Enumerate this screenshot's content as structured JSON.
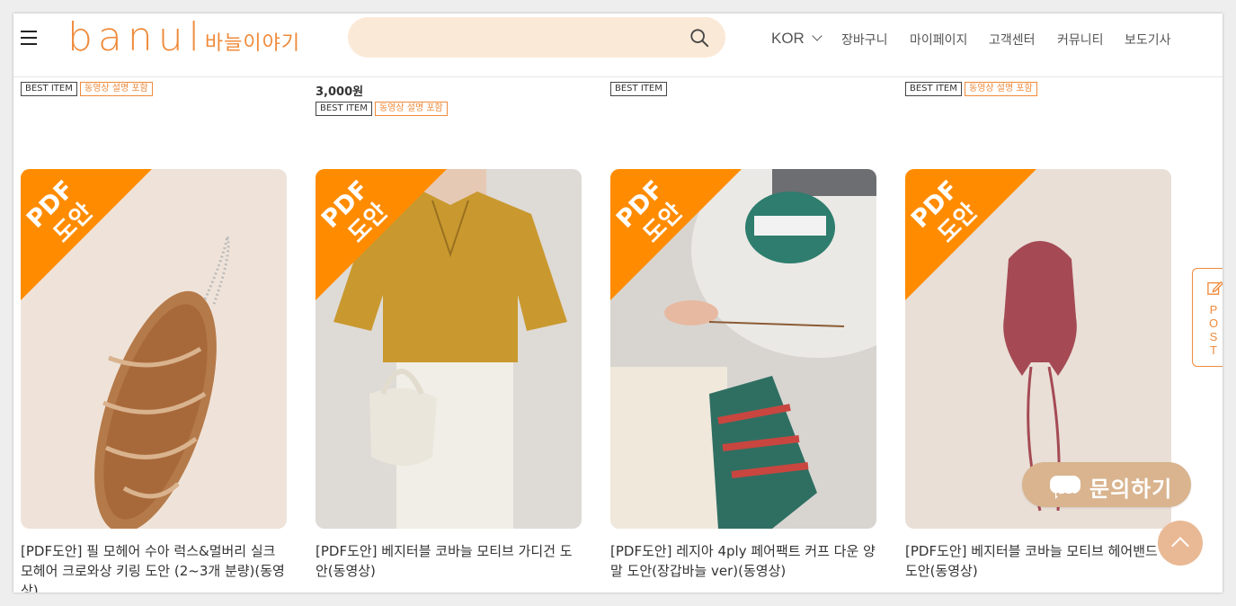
{
  "header": {
    "logo_latin": "banul",
    "logo_korean": "바늘이야기",
    "search": {
      "value": "",
      "placeholder": ""
    },
    "language": "KOR",
    "nav": [
      "장바구니",
      "마이페이지",
      "고객센터",
      "커뮤니티",
      "보도기사"
    ]
  },
  "previous_row": [
    {
      "price": "",
      "badges": [
        "BEST ITEM",
        "동영상 설명 포함"
      ]
    },
    {
      "price": "3,000원",
      "badges": [
        "BEST ITEM",
        "동영상 설명 포함"
      ]
    },
    {
      "price": "",
      "badges": [
        "BEST ITEM"
      ]
    },
    {
      "price": "",
      "badges": [
        "BEST ITEM",
        "동영상 설명 포함"
      ]
    }
  ],
  "ribbon": {
    "line1": "PDF",
    "line2": "도안"
  },
  "products": [
    {
      "title": "[PDF도안] 필 모헤어 수아 럭스&멀버리 실크 모헤어 크로와상 키링 도안 (2~3개 분량)(동영상)"
    },
    {
      "title": "[PDF도안] 베지터블 코바늘 모티브 가디건 도안(동영상)"
    },
    {
      "title": "[PDF도안] 레지아 4ply 페어팩트 커프 다운 양말 도안(장갑바늘 ver)(동영상)"
    },
    {
      "title": "[PDF도안] 베지터블 코바늘 모티브 헤어밴드 도안(동영상)"
    }
  ],
  "widgets": {
    "post": "POST",
    "inquiry": "문의하기"
  },
  "colors": {
    "brand": "#ef8b3c",
    "ribbon": "#ff8c00",
    "search_bg": "#fbe9d7",
    "inquiry_bg": "#d9b48f"
  }
}
